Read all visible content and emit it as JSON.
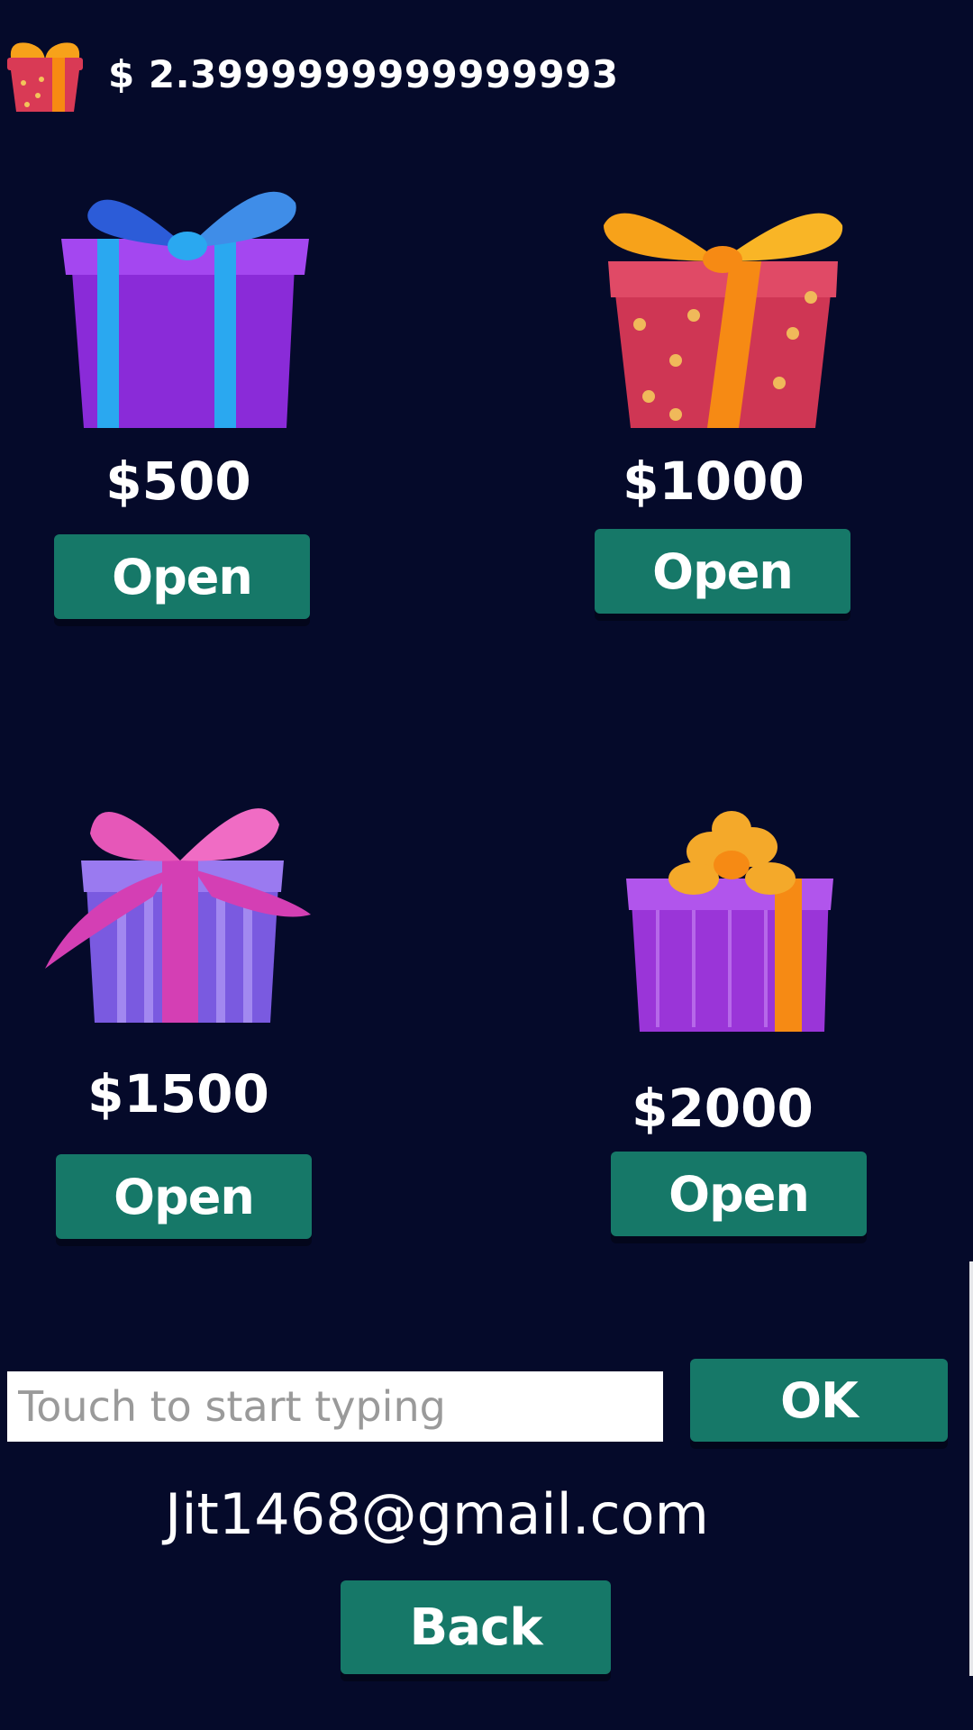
{
  "header": {
    "icon": "gift-box-icon",
    "balance": "$ 2.3999999999999993"
  },
  "gifts": [
    {
      "price": "$500",
      "button_label": "Open",
      "icon": "purple-gift-blue-ribbon"
    },
    {
      "price": "$1000",
      "button_label": "Open",
      "icon": "red-star-gift-orange-ribbon"
    },
    {
      "price": "$1500",
      "button_label": "Open",
      "icon": "striped-gift-pink-ribbon"
    },
    {
      "price": "$2000",
      "button_label": "Open",
      "icon": "purple-gift-gold-bow"
    }
  ],
  "input": {
    "placeholder": "Touch to start typing",
    "value": ""
  },
  "ok_label": "OK",
  "email": "Jit1468@gmail.com",
  "back_label": "Back",
  "colors": {
    "background": "#050a2a",
    "button": "#167868",
    "text": "#ffffff"
  }
}
